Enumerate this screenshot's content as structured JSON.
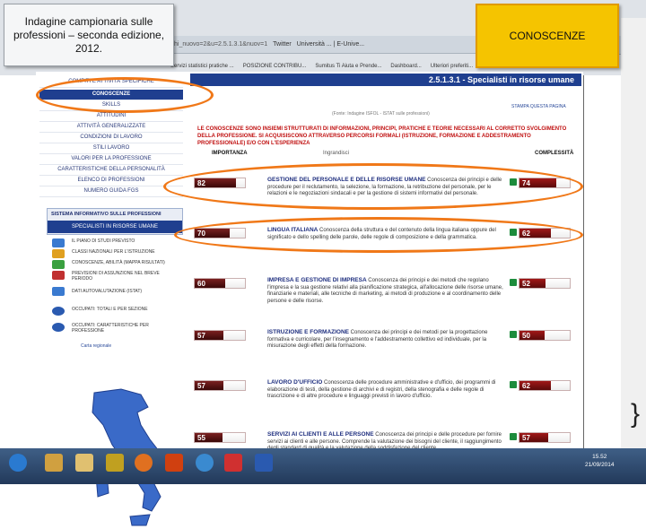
{
  "title_box": {
    "text": "Indagine campionaria sulle professioni – seconda edizione, 2012."
  },
  "badge_box": {
    "text": "CONOSCENZE"
  },
  "browser": {
    "url_fragment": "hi_nuovo=2&u=2.5.1.3.1&nuov=1",
    "tab_label": "Twitter",
    "tab_label_2": "Università ... | E-Unive...",
    "bookmarks": [
      "Servizi statistici pratiche ...",
      "POSIZIONE CONTRIBU...",
      "Sumitus Ti Aiuta e Prende...",
      "Dashboard...",
      "Ulteriori preferiti..."
    ]
  },
  "sidebar": {
    "items": [
      "COMPITI E ATTIVITÀ SPECIFICHE",
      "CONOSCENZE",
      "SKILLS",
      "ATTITUDINI",
      "ATTIVITÀ GENERALIZZATE",
      "CONDIZIONI DI LAVORO",
      "STILI LAVORO",
      "VALORI PER LA PROFESSIONE",
      "CARATTERISTICHE DELLA PERSONALITÀ",
      "ELENCO DI PROFESSIONI",
      "NUMERO GUIDA FGS"
    ],
    "system_title": "SISTEMA INFORMATIVO SULLE PROFESSIONI",
    "system_sub": "SPECIALISTI IN RISORSE UMANE",
    "links": [
      "IL PIANO DI STUDI PREVISTO",
      "CLASSI NAZIONALI PER L'ISTRUZIONE",
      "CONOSCENZE, ABILITÀ (MAPPA RISULTATI)",
      "PREVISIONI DI ASSUNZIONE NEL BREVE PERIODO",
      "DATI AUTOVALUTAZIONE (ISTAT)",
      "OCCUPATI: TOTALI E PER SEZIONE",
      "OCCUPATI: CARATTERISTICHE PER PROFESSIONE"
    ],
    "regions_link": "Carta regionale"
  },
  "main": {
    "header": "2.5.1.3.1 - Specialisti in risorse umane",
    "print_link": "STAMPA QUESTA PAGINA",
    "source_note": "(Fonte: Indagine ISFOL - ISTAT sulle professioni)",
    "intro": "Le conoscenze sono insiemi strutturati di informazioni, principi, pratiche e teorie necessari al corretto svolgimento della professione. Si acquisiscono attraverso percorsi formali (istruzione, formazione e addestramento professionale) e/o con l'esperienza",
    "col_importance": "IMPORTANZA",
    "col_complexity": "COMPLESSITÀ",
    "legend": "Ingrandisci"
  },
  "chart_data": {
    "type": "table",
    "columns": [
      "Conoscenza",
      "Importanza",
      "Complessità"
    ],
    "rows": [
      {
        "name": "GESTIONE DEL PERSONALE E DELLE RISORSE UMANE",
        "desc": "Conoscenza dei principi e delle procedure per il reclutamento, la selezione, la formazione, la retribuzione del personale, per le relazioni e le negoziazioni sindacali e per la gestione di sistemi informativi del personale.",
        "importance": 82,
        "complexity": 74
      },
      {
        "name": "LINGUA ITALIANA",
        "desc": "Conoscenza della struttura e del contenuto della lingua italiana oppure del significato e dello spelling delle parole, delle regole di composizione e della grammatica.",
        "importance": 70,
        "complexity": 62
      },
      {
        "name": "IMPRESA E GESTIONE DI IMPRESA",
        "desc": "Conoscenza dei principi e dei metodi che regolano l'impresa e la sua gestione relativi alla pianificazione strategica, all'allocazione delle risorse umane, finanziarie e materiali, alle tecniche di marketing, ai metodi di produzione e al coordinamento delle persone e delle risorse.",
        "importance": 60,
        "complexity": 52
      },
      {
        "name": "ISTRUZIONE E FORMAZIONE",
        "desc": "Conoscenza dei principi e dei metodi per la progettazione formativa e curricolare, per l'insegnamento e l'addestramento collettivo ed individuale, per la misurazione degli effetti della formazione.",
        "importance": 57,
        "complexity": 50
      },
      {
        "name": "LAVORO D'UFFICIO",
        "desc": "Conoscenza delle procedure amministrative e d'ufficio, dei programmi di elaborazione di testi, della gestione di archivi e di registri, della stenografia e delle regole di trascrizione e di altre procedure e linguaggi previsti in lavoro d'ufficio.",
        "importance": 57,
        "complexity": 62
      },
      {
        "name": "SERVIZI AI CLIENTI E ALLE PERSONE",
        "desc": "Conoscenza dei principi e delle procedure per fornire servizi ai clienti e alle persone. Comprende la valutazione dei bisogni del cliente, il raggiungimento degli standard di qualità e la valutazione della soddisfazione del cliente.",
        "importance": 55,
        "complexity": 57
      }
    ]
  },
  "taskbar": {
    "time": "15.52",
    "date": "21/09/2014"
  },
  "colors": {
    "accent_navy": "#1f3f8f",
    "highlight_orange": "#f07818",
    "badge_yellow": "#f5c400",
    "bar_dark_red": "#7a2020"
  }
}
